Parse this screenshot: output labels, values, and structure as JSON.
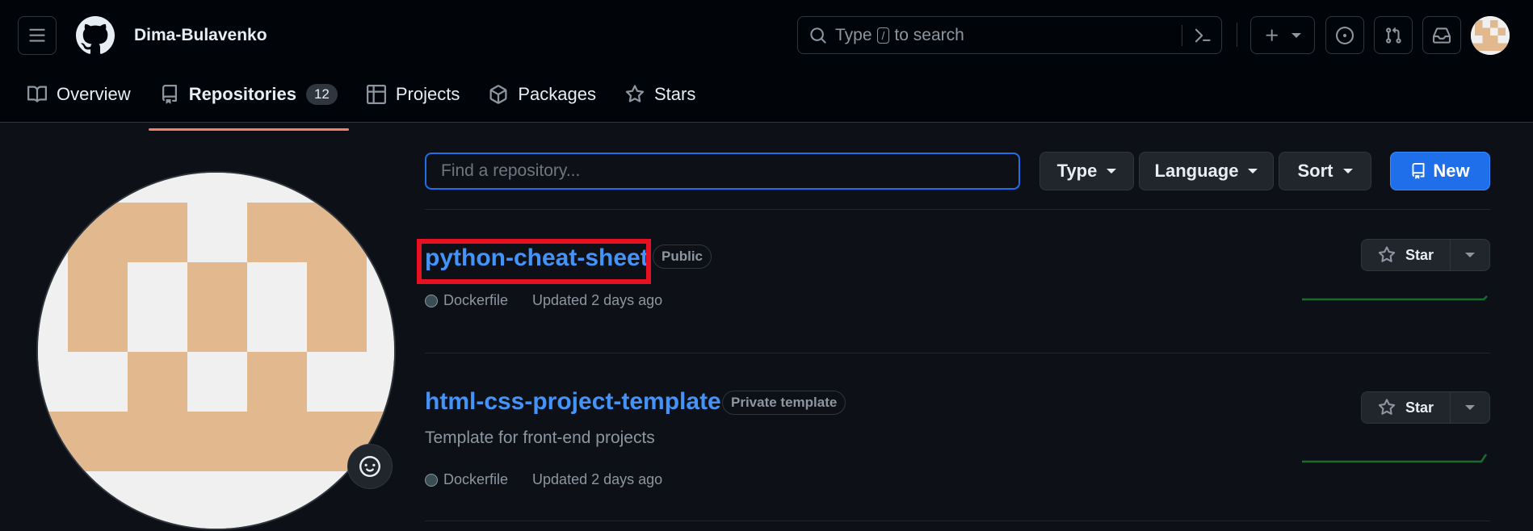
{
  "header": {
    "username": "Dima-Bulavenko",
    "search": {
      "prefix": "Type",
      "key": "/",
      "suffix": "to search"
    }
  },
  "nav": {
    "tabs": [
      {
        "label": "Overview",
        "icon": "book-icon"
      },
      {
        "label": "Repositories",
        "icon": "repo-icon",
        "count": "12",
        "selected": true
      },
      {
        "label": "Projects",
        "icon": "table-icon"
      },
      {
        "label": "Packages",
        "icon": "package-icon"
      },
      {
        "label": "Stars",
        "icon": "star-icon"
      }
    ]
  },
  "filters": {
    "find_placeholder": "Find a repository...",
    "type_label": "Type",
    "language_label": "Language",
    "sort_label": "Sort",
    "new_label": "New"
  },
  "repos": [
    {
      "name": "python-cheat-sheet",
      "visibility": "Public",
      "description": "",
      "language": "Dockerfile",
      "updated": "Updated 2 days ago",
      "star_label": "Star"
    },
    {
      "name": "html-css-project-template",
      "visibility": "Private template",
      "description": "Template for front-end projects",
      "language": "Dockerfile",
      "updated": "Updated 2 days ago",
      "star_label": "Star"
    }
  ],
  "colors": {
    "link": "#4493f8",
    "accent": "#1f6feb",
    "nav_underline": "#f78166",
    "highlight_box": "#e81123",
    "dockerfile_dot": "#384d54",
    "avatar_tan": "#e2b98e",
    "avatar_bg": "#f0f0f0",
    "sparkline": "#196c2e"
  }
}
